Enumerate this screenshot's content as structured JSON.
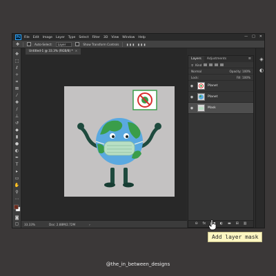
{
  "app": {
    "logo": "Ps"
  },
  "menu": [
    "File",
    "Edit",
    "Image",
    "Layer",
    "Type",
    "Select",
    "Filter",
    "3D",
    "View",
    "Window",
    "Help"
  ],
  "window_controls": {
    "minimize": "—",
    "maximize": "□",
    "close": "✕"
  },
  "options_bar": {
    "auto_select_label": "Auto-Select:",
    "auto_select_value": "Layer",
    "transform_label": "Show Transform Controls"
  },
  "document_tab": {
    "title": "Untitled-1 @ 33.3% (RGB/8) *",
    "close": "×"
  },
  "status_bar": {
    "zoom": "33.33%",
    "doc": "Doc: 2.88M/2.72M"
  },
  "layers_panel": {
    "tabs": [
      "Layers",
      "Adjustments"
    ],
    "menu_icon": "≡",
    "filter": {
      "kind": "Kind"
    },
    "blend_mode": "Normal",
    "opacity": "Opacity: 100%",
    "lock": "Lock:",
    "fill": "Fill: 100%",
    "layers": [
      {
        "name": "Planet",
        "visible": true,
        "selected": false,
        "thumb": "virus-sign-icon"
      },
      {
        "name": "Planet",
        "visible": true,
        "selected": false,
        "thumb": "planet-icon"
      },
      {
        "name": "Mask",
        "visible": true,
        "selected": true,
        "thumb": "mask-icon"
      }
    ],
    "bottom_icons": [
      "link-icon",
      "fx-icon",
      "add-layer-mask-icon",
      "adjustment-icon",
      "folder-icon",
      "new-layer-icon",
      "trash-icon"
    ],
    "bottom_glyphs": [
      "⊖",
      "fx",
      "▣",
      "◐",
      "▬",
      "⊞",
      "▥"
    ]
  },
  "tooltip": {
    "text": "Add layer mask"
  },
  "credit": "@the_in_between_designs",
  "colors": {
    "ocean": "#5aa9e0",
    "land": "#3a9d4a",
    "mask": "#b8dfc4",
    "tooltip_bg": "#fdf7c2"
  }
}
